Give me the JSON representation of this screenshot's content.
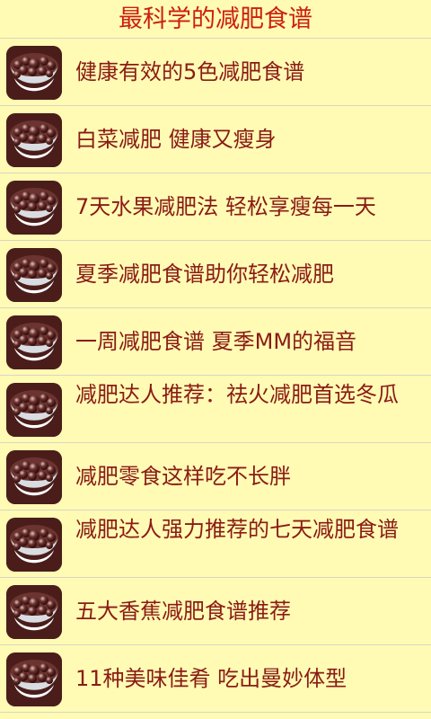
{
  "header": {
    "title": "最科学的减肥食谱"
  },
  "recipes": [
    {
      "title": "健康有效的5色减肥食谱"
    },
    {
      "title": "白菜减肥 健康又瘦身"
    },
    {
      "title": "7天水果减肥法 轻松享瘦每一天"
    },
    {
      "title": "夏季减肥食谱助你轻松减肥"
    },
    {
      "title": "一周减肥食谱 夏季MM的福音"
    },
    {
      "title": "减肥达人推荐：祛火减肥首选冬瓜"
    },
    {
      "title": "减肥零食这样吃不长胖"
    },
    {
      "title": "减肥达人强力推荐的七天减肥食谱"
    },
    {
      "title": "五大香蕉减肥食谱推荐"
    },
    {
      "title": "11种美味佳肴 吃出曼妙体型"
    }
  ],
  "thumbnail_icon": "bean-soup-bowl-icon",
  "colors": {
    "background": "#fffbb4",
    "title": "#cc1f12",
    "item_text": "#8a1b16",
    "divider": "#d9d5c2"
  }
}
